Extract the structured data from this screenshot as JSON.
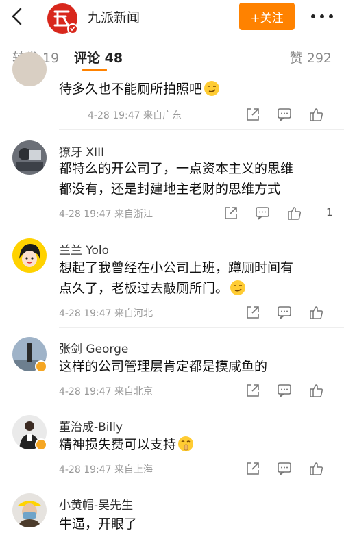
{
  "header": {
    "account_name": "九派新闻",
    "follow_label": "+关注"
  },
  "tabs": {
    "repost": "转发 19",
    "comments": "评论 48",
    "likes": "赞 292"
  },
  "comments": [
    {
      "username": "",
      "text": "待多久也不能厕所拍照吧",
      "time": "4-28 19:47",
      "location": "来自广东",
      "likes": ""
    },
    {
      "username": "獠牙 XIII",
      "text_line1": "都特么的开公司了，一点资本主义的思维",
      "text_line2": "都没有，还是封建地主老财的思维方式",
      "time": "4-28 19:47",
      "location": "来自浙江",
      "likes": "1"
    },
    {
      "username": "兰兰 Yolo",
      "text_line1": "想起了我曾经在小公司上班，蹲厕时间有",
      "text_line2": "点久了，老板过去敲厕所门。",
      "time": "4-28 19:47",
      "location": "来自河北",
      "likes": ""
    },
    {
      "username": "张剑 George",
      "text": "这样的公司管理层肯定都是摸咸鱼的",
      "time": "4-28 19:47",
      "location": "来自北京",
      "likes": ""
    },
    {
      "username": "董治成-Billy",
      "text": "精神损失费可以支持",
      "time": "4-28 19:47",
      "location": "来自上海",
      "likes": ""
    },
    {
      "username": "小黄帽-吴先生",
      "text": "牛逼，开眼了"
    }
  ],
  "colors": {
    "accent": "#ff8200",
    "verified": "#f5a623"
  },
  "icons": {
    "back": "back-arrow-icon",
    "more": "more-dots-icon",
    "share": "share-icon",
    "comment": "comment-icon",
    "like": "thumbs-up-icon"
  }
}
